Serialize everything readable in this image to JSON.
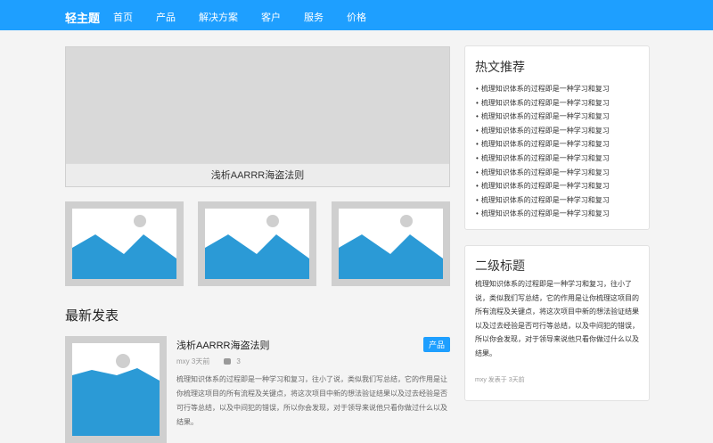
{
  "header": {
    "brand": "轻主题",
    "nav": [
      "首页",
      "产品",
      "解决方案",
      "客户",
      "服务",
      "价格"
    ]
  },
  "hero": {
    "caption": "浅析AARRR海盗法则"
  },
  "latest": {
    "title": "最新发表",
    "post": {
      "title": "浅析AARRR海盗法则",
      "tag": "产品",
      "author": "mxy",
      "time": "3天前",
      "comments": "3",
      "excerpt": "梳理知识体系的过程即是一种学习和复习，往小了说，类似我们写总结，它的作用是让你梳理这项目的所有流程及关键点，将这次项目中新的想法验证结果以及过去经验是否可行等总结，以及中间犯的错误，所以你会发现，对于领导来说他只看你做过什么以及结果。"
    }
  },
  "sidebar": {
    "hot": {
      "title": "热文推荐",
      "items": [
        "梳理知识体系的过程即是一种学习和复习",
        "梳理知识体系的过程即是一种学习和复习",
        "梳理知识体系的过程即是一种学习和复习",
        "梳理知识体系的过程即是一种学习和复习",
        "梳理知识体系的过程即是一种学习和复习",
        "梳理知识体系的过程即是一种学习和复习",
        "梳理知识体系的过程即是一种学习和复习",
        "梳理知识体系的过程即是一种学习和复习",
        "梳理知识体系的过程即是一种学习和复习",
        "梳理知识体系的过程即是一种学习和复习"
      ]
    },
    "second": {
      "title": "二级标题",
      "body": "梳理知识体系的过程即是一种学习和复习，往小了说，类似我们写总结，它的作用是让你梳理这项目的所有流程及关键点，将这次项目中新的想法验证结果以及过去经验是否可行等总结，以及中间犯的错误，所以你会发现，对于领导来说他只看你做过什么以及结果。",
      "meta": "mxy 发表于 3天前"
    }
  },
  "colors": {
    "accent": "#1e9fff",
    "image_blue": "#2b9ad6",
    "image_frame": "#cfcfcf"
  },
  "icons": {
    "image_placeholder": "image-placeholder-icon",
    "comment": "comment-icon"
  }
}
